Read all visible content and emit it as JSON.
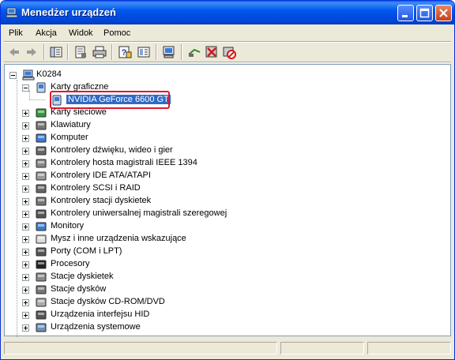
{
  "window": {
    "title": "Menedżer urządzeń"
  },
  "menu": [
    "Plik",
    "Akcja",
    "Widok",
    "Pomoc"
  ],
  "toolbar": {
    "icons": [
      "back-arrow-icon",
      "forward-arrow-icon",
      "show-hide-tree-icon",
      "properties-icon",
      "print-icon",
      "help-icon",
      "view-icon",
      "scan-hardware-icon",
      "update-driver-icon",
      "uninstall-icon",
      "disable-icon"
    ]
  },
  "tree": {
    "root": "K0284",
    "categories": [
      {
        "label": "Karty graficzne",
        "expanded": true,
        "children": [
          "NVIDIA GeForce 6600 GT"
        ]
      },
      {
        "label": "Karty sieciowe"
      },
      {
        "label": "Klawiatury"
      },
      {
        "label": "Komputer"
      },
      {
        "label": "Kontrolery dźwięku, wideo i gier"
      },
      {
        "label": "Kontrolery hosta magistrali IEEE 1394"
      },
      {
        "label": "Kontrolery IDE ATA/ATAPI"
      },
      {
        "label": "Kontrolery SCSI i RAID"
      },
      {
        "label": "Kontrolery stacji dyskietek"
      },
      {
        "label": "Kontrolery uniwersalnej magistrali szeregowej"
      },
      {
        "label": "Monitory"
      },
      {
        "label": "Mysz i inne urządzenia wskazujące"
      },
      {
        "label": "Porty (COM i LPT)"
      },
      {
        "label": "Procesory"
      },
      {
        "label": "Stacje dyskietek"
      },
      {
        "label": "Stacje dysków"
      },
      {
        "label": "Stacje dysków CD-ROM/DVD"
      },
      {
        "label": "Urządzenia interfejsu HID"
      },
      {
        "label": "Urządzenia systemowe"
      }
    ]
  },
  "colors": {
    "titlebar": "#0058ee",
    "selection": "#316ac5",
    "highlight": "#e0182c"
  }
}
